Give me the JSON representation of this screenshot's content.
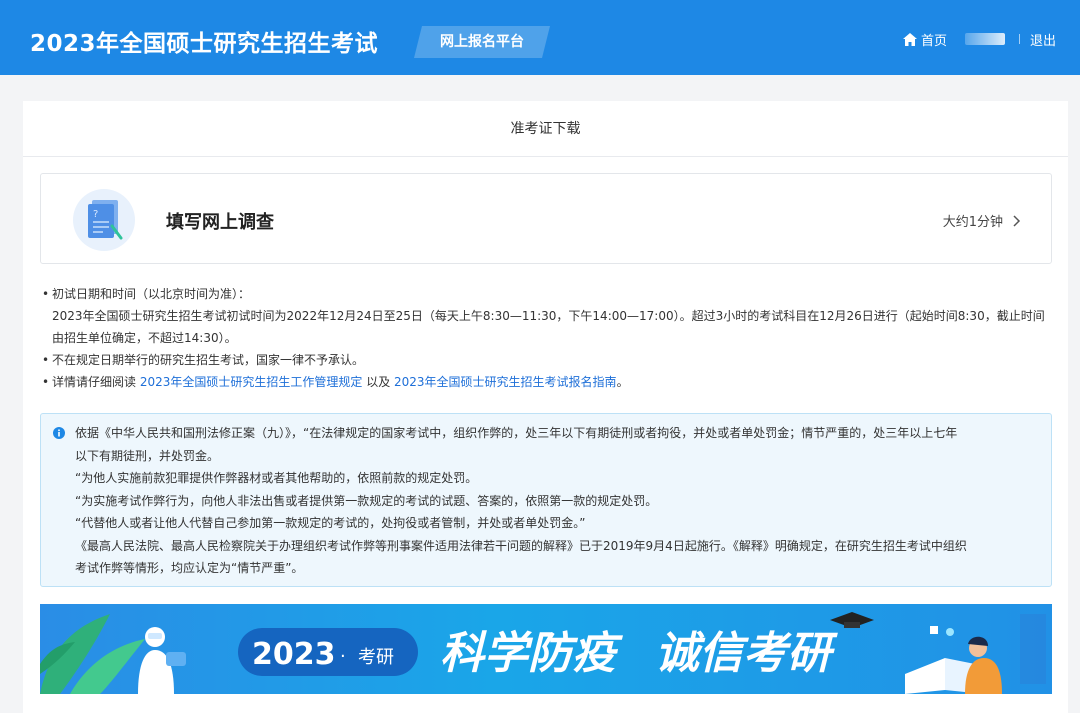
{
  "header": {
    "title": "2023年全国硕士研究生招生考试",
    "platform": "网上报名平台",
    "home": "首页",
    "logout": "退出"
  },
  "panel": {
    "title": "准考证下载"
  },
  "survey": {
    "title": "填写网上调查",
    "time": "大约1分钟"
  },
  "info": {
    "line1": "初试日期和时间（以北京时间为准）：",
    "line1_detail_a": "2023年全国硕士研究生招生考试初试时间为2022年12月24日至25日（每天上午8:30—11:30，下午14:00—17:00）。超过3小时的考试科目在12月26日进行（起始时间8:30，截止时间",
    "line1_detail_b": "由招生单位确定，不超过14:30）。",
    "line2": "不在规定日期举行的研究生招生考试，国家一律不予承认。",
    "line3_prefix": "详情请仔细阅读 ",
    "line3_link1": "2023年全国硕士研究生招生工作管理规定",
    "line3_mid": " 以及 ",
    "line3_link2": "2023年全国硕士研究生招生考试报名指南",
    "line3_suffix": "。"
  },
  "notice": {
    "p1a": "依据《中华人民共和国刑法修正案（九）》，“在法律规定的国家考试中，组织作弊的，处三年以下有期徒刑或者拘役，并处或者单处罚金；情节严重的，处三年以上七年",
    "p1b": "以下有期徒刑，并处罚金。",
    "p2": "“为他人实施前款犯罪提供作弊器材或者其他帮助的，依照前款的规定处罚。",
    "p3": "“为实施考试作弊行为，向他人非法出售或者提供第一款规定的考试的试题、答案的，依照第一款的规定处罚。",
    "p4": "“代替他人或者让他人代替自己参加第一款规定的考试的，处拘役或者管制，并处或者单处罚金。”",
    "p5a": "《最高人民法院、最高人民检察院关于办理组织考试作弊等刑事案件适用法律若干问题的解释》已于2019年9月4日起施行。《解释》明确规定，在研究生招生考试中组织",
    "p5b": "考试作弊等情形，均应认定为“情节严重”。"
  },
  "banner": {
    "year": "2023",
    "dot": "·",
    "kaoyan": "考研",
    "slogan1": "科学防疫",
    "slogan2": "诚信考研"
  },
  "colors": {
    "header_bg": "#1e88e5",
    "link": "#1e6fd8",
    "notice_bg": "#eef7fd",
    "notice_border": "#bde1f6",
    "banner_text": "#ffffff"
  }
}
